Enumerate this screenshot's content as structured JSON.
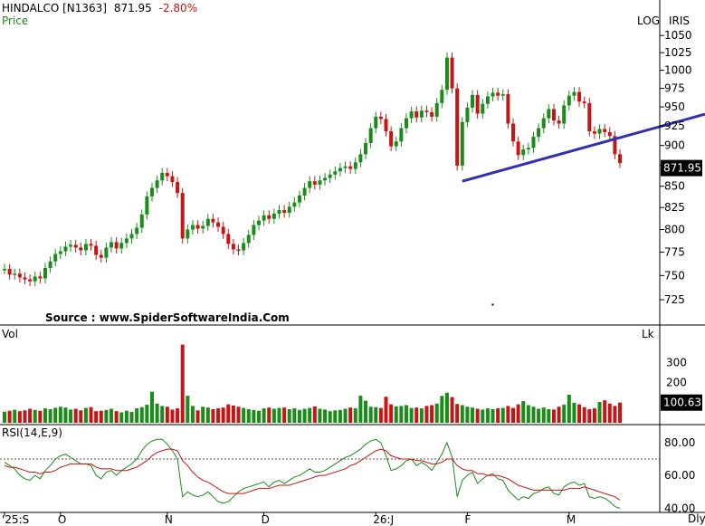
{
  "header": {
    "symbol": "HINDALCO [N1363]",
    "last_price": "871.95",
    "change": "-2.80%",
    "price_label": "Price",
    "scale_mode": "LOG",
    "software": "IRIS",
    "volume_label": "Vol",
    "volume_unit": "Lk",
    "rsi_label": "RSI(14,E,9)",
    "source": "Source : www.SpiderSoftwareIndia.Com",
    "interval": "Dly"
  },
  "colors": {
    "up": "#1a8c1a",
    "down": "#c81414",
    "trendline": "#3030b0",
    "rsi_line": "#1a8c1a",
    "rsi_signal": "#c81414",
    "change_text": "#c81414",
    "price_label_text": "#1a8c1a"
  },
  "chart_data": [
    {
      "type": "candlestick",
      "title": "HINDALCO [N1363]",
      "scale": "log",
      "ylim": [
        706,
        1065
      ],
      "y_ticks": [
        725,
        750,
        775,
        800,
        825,
        850,
        875,
        900,
        925,
        950,
        975,
        1000,
        1025,
        1050
      ],
      "last_value": "871.95",
      "x_ticks": [
        "'25:S",
        "O",
        "N",
        "D",
        "26:J",
        "F",
        "M"
      ],
      "closes": [
        757,
        751,
        752,
        748,
        746,
        744,
        749,
        747,
        758,
        765,
        773,
        776,
        781,
        783,
        780,
        777,
        784,
        782,
        772,
        769,
        780,
        786,
        779,
        785,
        790,
        795,
        802,
        817,
        838,
        848,
        857,
        866,
        862,
        855,
        842,
        790,
        800,
        805,
        801,
        804,
        812,
        808,
        803,
        795,
        784,
        778,
        777,
        785,
        794,
        805,
        810,
        816,
        812,
        818,
        822,
        819,
        826,
        831,
        839,
        848,
        856,
        852,
        857,
        860,
        864,
        868,
        872,
        874,
        871,
        879,
        889,
        903,
        922,
        937,
        934,
        918,
        899,
        905,
        922,
        935,
        944,
        936,
        945,
        943,
        937,
        955,
        973,
        1018,
        975,
        875,
        930,
        949,
        966,
        941,
        954,
        964,
        969,
        965,
        967,
        928,
        905,
        888,
        895,
        897,
        911,
        922,
        935,
        947,
        932,
        928,
        952,
        965,
        970,
        957,
        955,
        918,
        915,
        921,
        917,
        912,
        889,
        878
      ],
      "markers": [
        {
          "x_index": 96,
          "value": 720
        }
      ],
      "trendline": {
        "from": {
          "x_index": 90,
          "value": 856
        },
        "to": {
          "x_index": 131,
          "value": 928
        }
      }
    },
    {
      "type": "bar",
      "title": "Vol",
      "unit": "Lk",
      "ylim": [
        0,
        420
      ],
      "y_ticks": [
        100,
        200,
        300
      ],
      "last_value": "100.63",
      "values": [
        55,
        60,
        65,
        58,
        62,
        70,
        64,
        60,
        72,
        68,
        75,
        80,
        76,
        66,
        70,
        62,
        74,
        78,
        58,
        60,
        64,
        70,
        58,
        52,
        60,
        55,
        72,
        78,
        90,
        155,
        96,
        84,
        80,
        66,
        72,
        390,
        135,
        84,
        62,
        80,
        76,
        68,
        72,
        76,
        92,
        86,
        80,
        74,
        68,
        64,
        60,
        72,
        76,
        70,
        74,
        76,
        68,
        72,
        64,
        70,
        74,
        82,
        70,
        66,
        58,
        62,
        64,
        70,
        76,
        72,
        135,
        110,
        80,
        78,
        74,
        130,
        92,
        82,
        84,
        88,
        74,
        76,
        72,
        84,
        88,
        96,
        134,
        150,
        128,
        94,
        88,
        80,
        76,
        70,
        66,
        72,
        68,
        72,
        74,
        84,
        74,
        92,
        108,
        88,
        80,
        70,
        76,
        68,
        66,
        80,
        90,
        140,
        100,
        92,
        78,
        68,
        72,
        104,
        112,
        96,
        84,
        101
      ]
    },
    {
      "type": "line",
      "title": "RSI(14,E,9)",
      "ylim": [
        38,
        86
      ],
      "y_ticks": [
        40,
        60,
        80
      ],
      "reference_line": 70,
      "series": [
        {
          "name": "RSI",
          "values": [
            68,
            66,
            64,
            60,
            58,
            57,
            60,
            58,
            63,
            66,
            70,
            72,
            73,
            71,
            69,
            67,
            67,
            66,
            60,
            58,
            62,
            63,
            60,
            63,
            65,
            67,
            70,
            75,
            79,
            81,
            82,
            82,
            79,
            75,
            70,
            47,
            50,
            48,
            47,
            48,
            50,
            47,
            44,
            43,
            44,
            47,
            50,
            52,
            53,
            54,
            55,
            56,
            53,
            56,
            57,
            55,
            57,
            59,
            60,
            62,
            64,
            62,
            62,
            63,
            65,
            67,
            69,
            71,
            72,
            74,
            76,
            79,
            81,
            82,
            80,
            72,
            63,
            64,
            66,
            69,
            70,
            66,
            68,
            66,
            63,
            68,
            73,
            80,
            71,
            47,
            57,
            60,
            62,
            55,
            58,
            60,
            61,
            58,
            57,
            51,
            48,
            45,
            47,
            46,
            49,
            50,
            52,
            53,
            49,
            48,
            53,
            55,
            56,
            54,
            55,
            47,
            46,
            47,
            46,
            44,
            41,
            40
          ]
        },
        {
          "name": "Signal",
          "values": [
            66,
            65,
            65,
            64,
            63,
            62,
            62,
            61,
            62,
            62,
            63,
            65,
            66,
            67,
            67,
            67,
            67,
            67,
            65,
            64,
            64,
            64,
            63,
            63,
            63,
            64,
            65,
            67,
            69,
            72,
            74,
            75,
            76,
            76,
            75,
            69,
            66,
            62,
            59,
            57,
            56,
            54,
            52,
            50,
            49,
            49,
            49,
            49,
            50,
            51,
            52,
            52,
            52,
            53,
            54,
            54,
            54,
            55,
            56,
            57,
            58,
            59,
            60,
            60,
            61,
            62,
            63,
            64,
            66,
            67,
            69,
            71,
            73,
            75,
            76,
            75,
            72,
            71,
            70,
            70,
            70,
            69,
            69,
            68,
            67,
            67,
            68,
            70,
            70,
            66,
            64,
            63,
            63,
            61,
            61,
            60,
            60,
            60,
            59,
            58,
            56,
            54,
            53,
            52,
            51,
            51,
            51,
            51,
            51,
            51,
            51,
            52,
            52,
            52,
            53,
            52,
            51,
            50,
            49,
            48,
            47,
            45
          ]
        }
      ]
    }
  ]
}
